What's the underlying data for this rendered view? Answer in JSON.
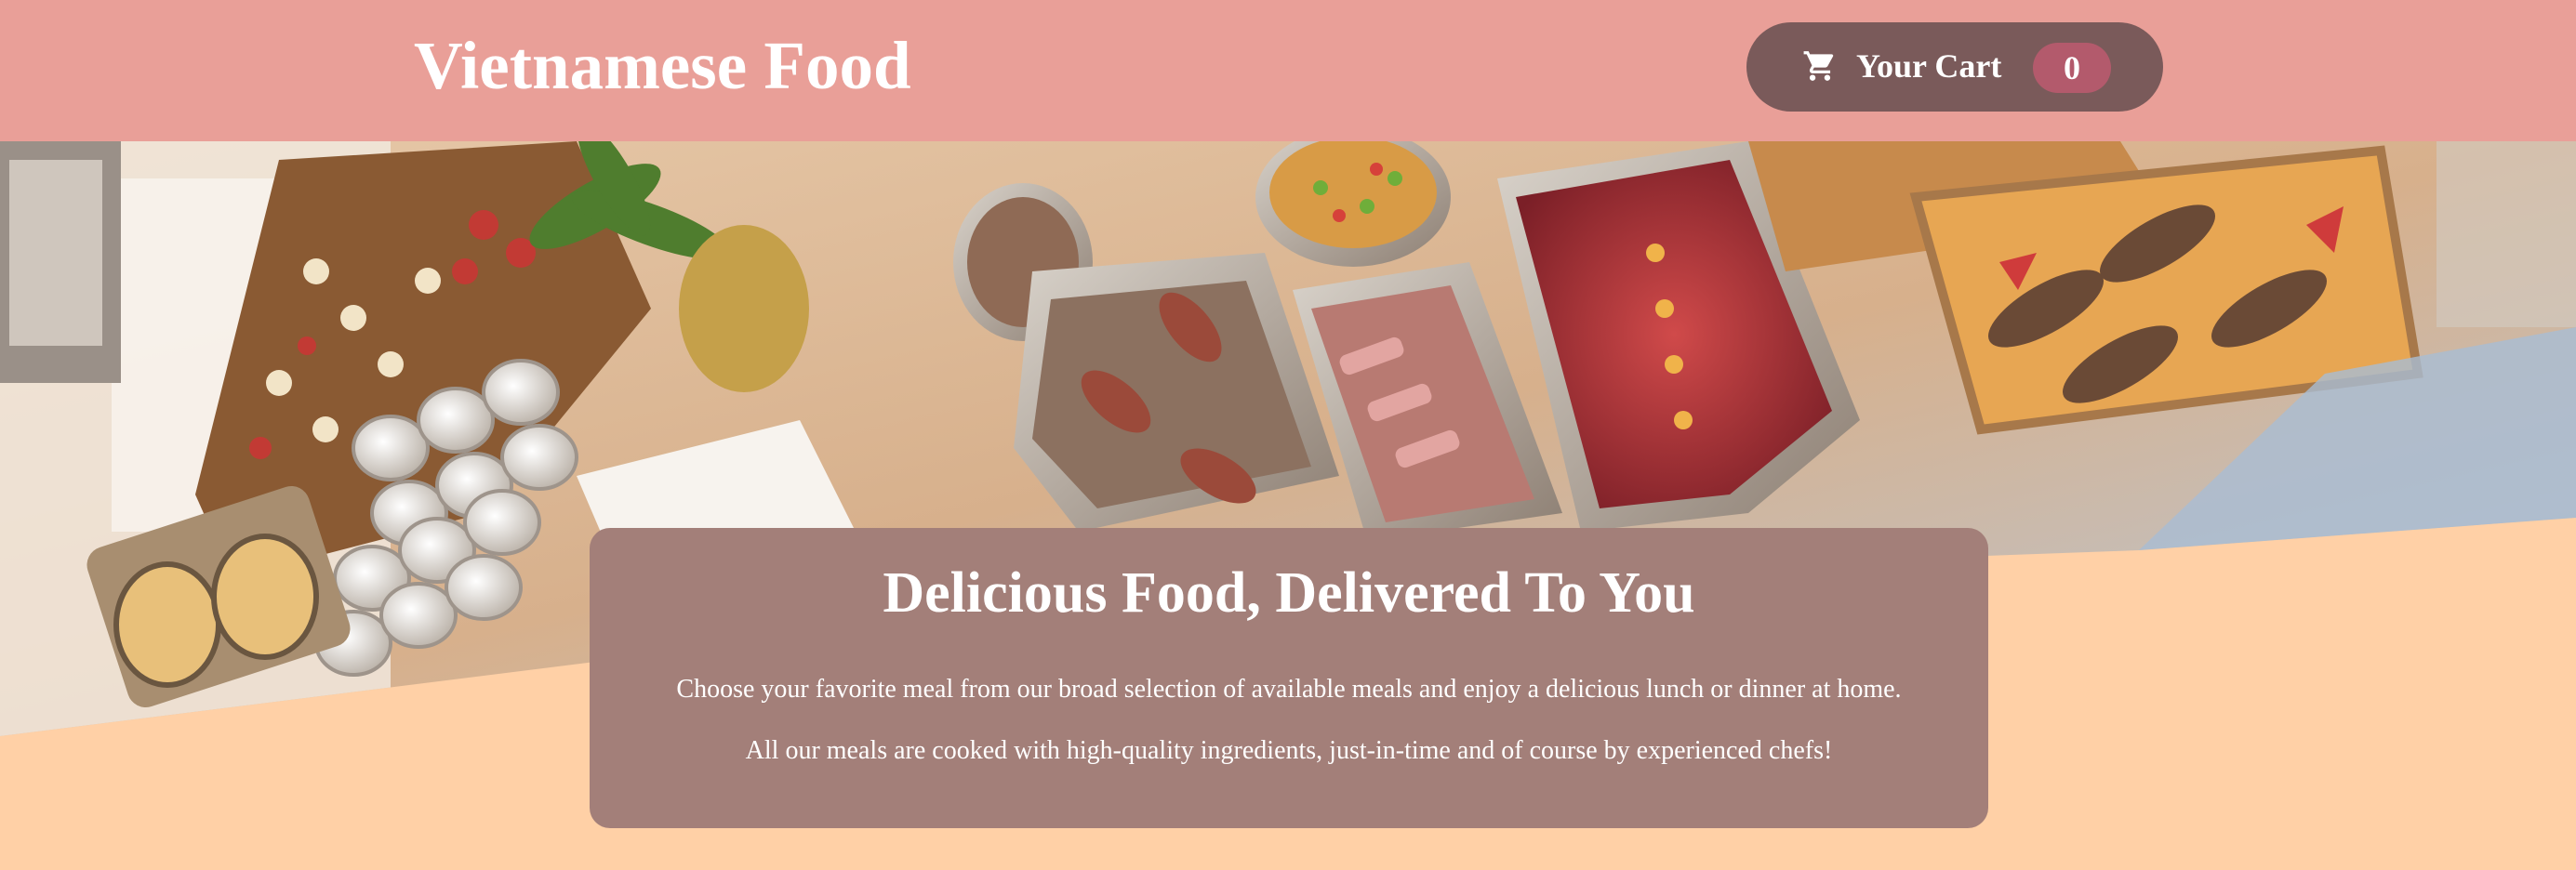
{
  "header": {
    "title": "Vietnamese Food",
    "cart": {
      "label": "Your Cart",
      "count": "0",
      "icon": "shopping-cart-icon"
    }
  },
  "hero": {
    "image": "banquet-table-image"
  },
  "summary": {
    "title": "Delicious Food, Delivered To You",
    "paragraphs": [
      "Choose your favorite meal from our broad selection of available meals and enjoy a delicious lunch or dinner at home.",
      "All our meals are cooked with high-quality ingredients, just-in-time and of course by experienced chefs!"
    ]
  },
  "colors": {
    "header_bg": "#e99f98",
    "page_bg": "#ffd0a6",
    "cart_button_bg": "#7a5a5a",
    "cart_badge_bg": "#b35a6c",
    "summary_bg": "#a37f79",
    "text": "#ffffff"
  }
}
